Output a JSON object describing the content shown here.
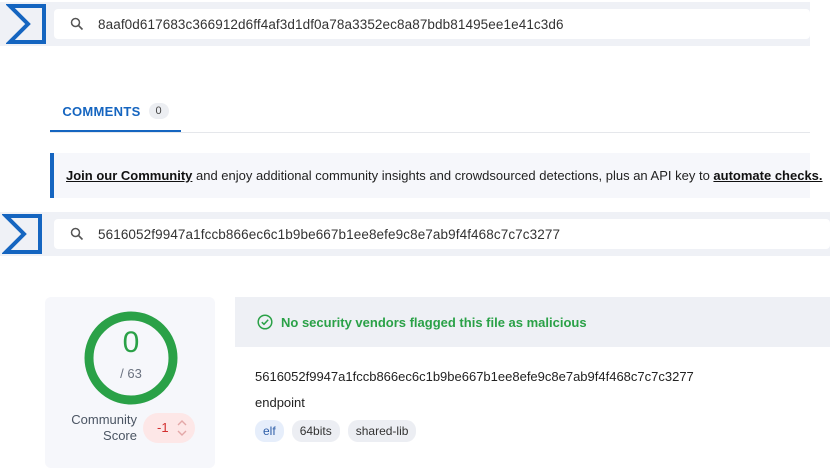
{
  "top_search": {
    "value": "8aaf0d617683c366912d6ff4af3d1df0a78a3352ec8a87bdb81495ee1e41c3d6"
  },
  "tabs": [
    {
      "label": "COMMENTS",
      "count": "0"
    }
  ],
  "banner": {
    "link1": "Join our Community",
    "text": " and enjoy additional community insights and crowdsourced detections, plus an API key to ",
    "link2": "automate checks."
  },
  "mid_search": {
    "value": "5616052f9947a1fccb866ec6c1b9be667b1ee8efe9c8e7ab9f4f468c7c7c3277"
  },
  "score": {
    "detections": "0",
    "total": "/ 63",
    "detection_ratio": 0,
    "community_label_1": "Community",
    "community_label_2": "Score",
    "community_value": "-1"
  },
  "detail": {
    "status": "No security vendors flagged this file as malicious",
    "hash": "5616052f9947a1fccb866ec6c1b9be667b1ee8efe9c8e7ab9f4f468c7c7c3277",
    "name": "endpoint",
    "tags": [
      "elf",
      "64bits",
      "shared-lib"
    ]
  },
  "colors": {
    "brand": "#1565c0",
    "clean": "#2aa147",
    "negative": "#d32f2f"
  },
  "icons": {
    "logo": "virustotal-sigma-logo",
    "search": "search-icon",
    "check": "check-circle-icon"
  }
}
